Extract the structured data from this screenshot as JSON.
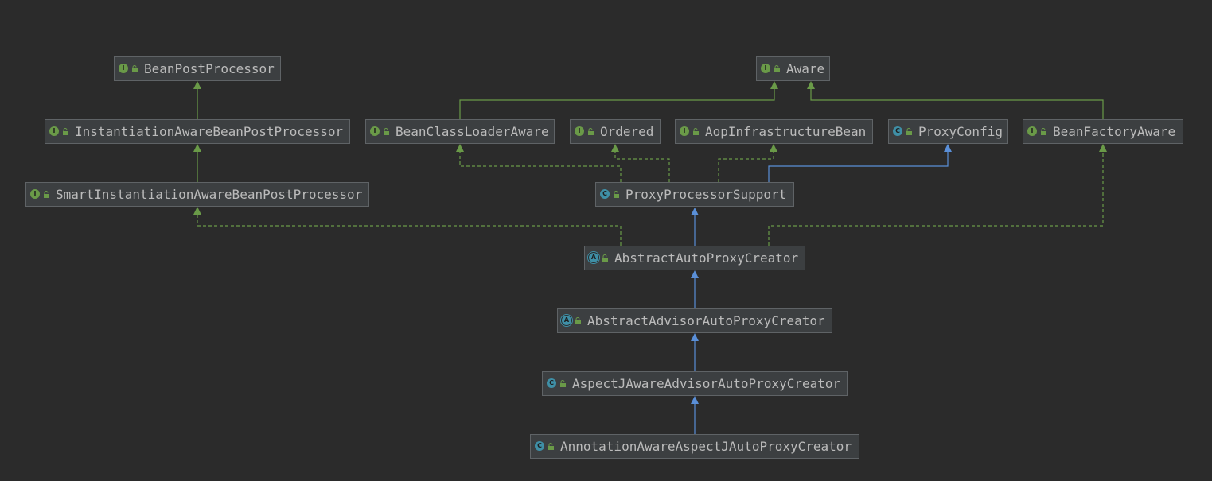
{
  "colors": {
    "background": "#2b2b2b",
    "node_fill": "#3c3f41",
    "node_border": "#5f6366",
    "text": "#bbbbbb",
    "interface_edge": "#6a9a48",
    "extends_edge": "#5a8fd8",
    "interface_icon": "#6a9a48",
    "class_icon": "#3f8fa6"
  },
  "nodes": [
    {
      "id": "BeanPostProcessor",
      "label": "BeanPostProcessor",
      "kind": "interface",
      "kind_glyph": "I",
      "icon": "interface-icon"
    },
    {
      "id": "InstantiationAwareBeanPostProcessor",
      "label": "InstantiationAwareBeanPostProcessor",
      "kind": "interface",
      "kind_glyph": "I",
      "icon": "interface-icon"
    },
    {
      "id": "SmartInstantiationAwareBeanPostProcessor",
      "label": "SmartInstantiationAwareBeanPostProcessor",
      "kind": "interface",
      "kind_glyph": "I",
      "icon": "interface-icon"
    },
    {
      "id": "Aware",
      "label": "Aware",
      "kind": "interface",
      "kind_glyph": "I",
      "icon": "interface-icon"
    },
    {
      "id": "BeanClassLoaderAware",
      "label": "BeanClassLoaderAware",
      "kind": "interface",
      "kind_glyph": "I",
      "icon": "interface-icon"
    },
    {
      "id": "Ordered",
      "label": "Ordered",
      "kind": "interface",
      "kind_glyph": "I",
      "icon": "interface-icon"
    },
    {
      "id": "AopInfrastructureBean",
      "label": "AopInfrastructureBean",
      "kind": "interface",
      "kind_glyph": "I",
      "icon": "interface-icon"
    },
    {
      "id": "ProxyConfig",
      "label": "ProxyConfig",
      "kind": "class",
      "kind_glyph": "C",
      "icon": "class-icon"
    },
    {
      "id": "BeanFactoryAware",
      "label": "BeanFactoryAware",
      "kind": "interface",
      "kind_glyph": "I",
      "icon": "interface-icon"
    },
    {
      "id": "ProxyProcessorSupport",
      "label": "ProxyProcessorSupport",
      "kind": "class",
      "kind_glyph": "C",
      "icon": "class-icon"
    },
    {
      "id": "AbstractAutoProxyCreator",
      "label": "AbstractAutoProxyCreator",
      "kind": "abstract",
      "kind_glyph": "A",
      "icon": "abstract-class-icon"
    },
    {
      "id": "AbstractAdvisorAutoProxyCreator",
      "label": "AbstractAdvisorAutoProxyCreator",
      "kind": "abstract",
      "kind_glyph": "A",
      "icon": "abstract-class-icon"
    },
    {
      "id": "AspectJAwareAdvisorAutoProxyCreator",
      "label": "AspectJAwareAdvisorAutoProxyCreator",
      "kind": "class",
      "kind_glyph": "C",
      "icon": "class-icon"
    },
    {
      "id": "AnnotationAwareAspectJAutoProxyCreator",
      "label": "AnnotationAwareAspectJAutoProxyCreator",
      "kind": "class",
      "kind_glyph": "C",
      "icon": "class-icon"
    }
  ],
  "edges": [
    {
      "from": "InstantiationAwareBeanPostProcessor",
      "to": "BeanPostProcessor",
      "type": "interface-extends"
    },
    {
      "from": "SmartInstantiationAwareBeanPostProcessor",
      "to": "InstantiationAwareBeanPostProcessor",
      "type": "interface-extends"
    },
    {
      "from": "BeanClassLoaderAware",
      "to": "Aware",
      "type": "interface-extends"
    },
    {
      "from": "BeanFactoryAware",
      "to": "Aware",
      "type": "interface-extends"
    },
    {
      "from": "ProxyProcessorSupport",
      "to": "BeanClassLoaderAware",
      "type": "implements"
    },
    {
      "from": "ProxyProcessorSupport",
      "to": "Ordered",
      "type": "implements"
    },
    {
      "from": "ProxyProcessorSupport",
      "to": "AopInfrastructureBean",
      "type": "implements"
    },
    {
      "from": "ProxyProcessorSupport",
      "to": "ProxyConfig",
      "type": "extends"
    },
    {
      "from": "AbstractAutoProxyCreator",
      "to": "ProxyProcessorSupport",
      "type": "extends"
    },
    {
      "from": "AbstractAutoProxyCreator",
      "to": "SmartInstantiationAwareBeanPostProcessor",
      "type": "implements"
    },
    {
      "from": "AbstractAutoProxyCreator",
      "to": "BeanFactoryAware",
      "type": "implements"
    },
    {
      "from": "AbstractAdvisorAutoProxyCreator",
      "to": "AbstractAutoProxyCreator",
      "type": "extends"
    },
    {
      "from": "AspectJAwareAdvisorAutoProxyCreator",
      "to": "AbstractAdvisorAutoProxyCreator",
      "type": "extends"
    },
    {
      "from": "AnnotationAwareAspectJAutoProxyCreator",
      "to": "AspectJAwareAdvisorAutoProxyCreator",
      "type": "extends"
    }
  ]
}
